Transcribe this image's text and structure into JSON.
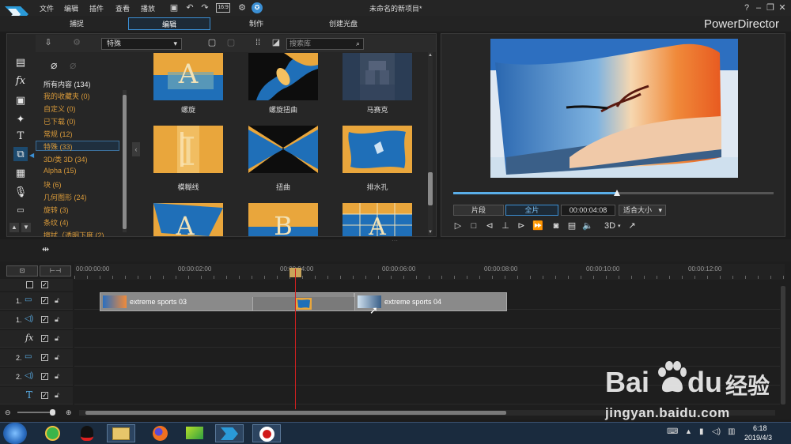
{
  "app": {
    "title": "未命名的新项目*",
    "brand": "PowerDirector",
    "menu": [
      "文件",
      "编辑",
      "插件",
      "查看",
      "播放"
    ],
    "tb_button_label": "16:9"
  },
  "modes": [
    "捕捉",
    "编辑",
    "制作",
    "创建光盘"
  ],
  "active_mode": "编辑",
  "library": {
    "dropdown": "特殊",
    "search_placeholder": "搜索库",
    "categories": [
      {
        "label": "所有内容 (134)"
      },
      {
        "label": "我的收藏夹 (0)"
      },
      {
        "label": "自定义 (0)"
      },
      {
        "label": "已下载 (0)"
      },
      {
        "label": "常规 (12)"
      },
      {
        "label": "特殊 (33)"
      },
      {
        "label": "3D/类 3D (34)"
      },
      {
        "label": "Alpha (15)"
      },
      {
        "label": "块 (6)"
      },
      {
        "label": "几何图形 (24)"
      },
      {
        "label": "旋转 (3)"
      },
      {
        "label": "条纹 (4)"
      },
      {
        "label": "擦拭（透明下度 (2)"
      }
    ],
    "selected_category": "特殊 (33)",
    "thumbnails": [
      {
        "label": "螺旋"
      },
      {
        "label": "螺旋扭曲"
      },
      {
        "label": "马赛克"
      },
      {
        "label": "模糊线"
      },
      {
        "label": "扭曲"
      },
      {
        "label": "排水孔"
      },
      {
        "label": ""
      },
      {
        "label": ""
      },
      {
        "label": ""
      }
    ]
  },
  "preview": {
    "mode_clip": "片段",
    "mode_full": "全片",
    "timecode": "00:00:04:08",
    "fit": "适合大小",
    "three_d": "3D",
    "progress": 0.51
  },
  "timeline": {
    "ticks": [
      "00:00:00:00",
      "00:00:02:00",
      "00:00:04:00",
      "00:00:06:00",
      "00:00:08:00",
      "00:00:10:00",
      "00:00:12:00"
    ],
    "tracks": [
      {
        "num": "1.",
        "kind": "video"
      },
      {
        "num": "1.",
        "kind": "audio"
      },
      {
        "num": "",
        "kind": "fx"
      },
      {
        "num": "2.",
        "kind": "video"
      },
      {
        "num": "2.",
        "kind": "audio"
      },
      {
        "num": "",
        "kind": "title"
      }
    ],
    "clips": [
      {
        "label": "extreme sports 03"
      },
      {
        "label": "extreme sports 04"
      }
    ]
  },
  "taskbar": {
    "time": "6:18",
    "date": "2019/4/3"
  },
  "watermark": {
    "brand": "Bai",
    "brand2": "du",
    "cn": "经验",
    "url": "jingyan.baidu.com"
  },
  "colors": {
    "accent": "#3b8fd4",
    "category_text": "#d99a3a",
    "playhead": "#d02020"
  }
}
